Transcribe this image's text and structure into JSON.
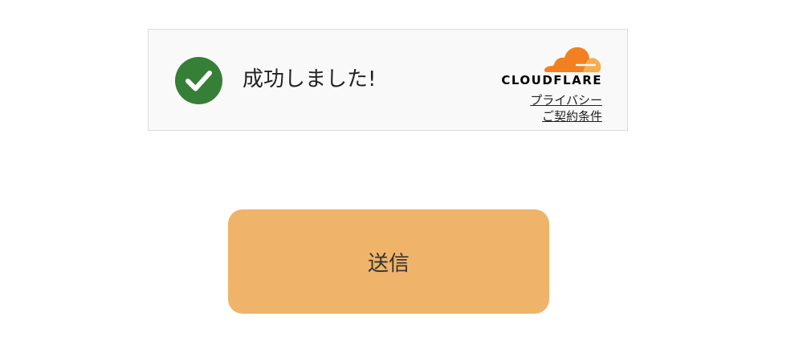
{
  "challenge": {
    "status_text": "成功しました!",
    "status_icon": "check-circle-icon",
    "status_color": "#367f36",
    "brand": {
      "name": "CLOUDFLARE",
      "icon": "cloudflare-cloud-icon",
      "cloud_color": "#f38020"
    },
    "links": {
      "privacy": "プライバシー",
      "terms": "ご契約条件"
    }
  },
  "form": {
    "submit_label": "送信",
    "submit_color": "#efb46a"
  }
}
